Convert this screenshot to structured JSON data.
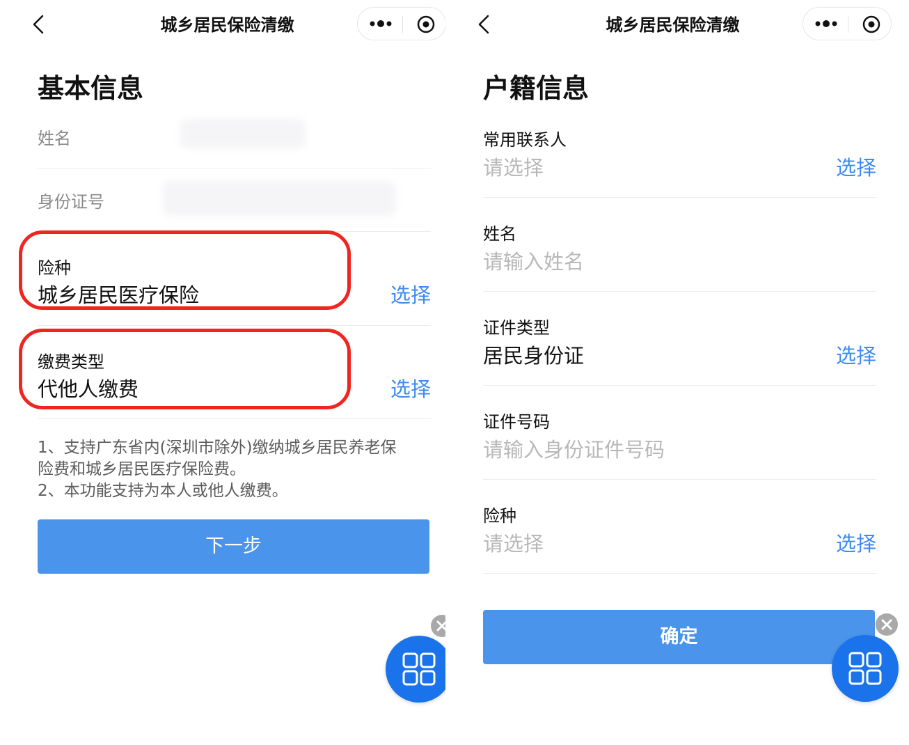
{
  "left": {
    "nav": {
      "title": "城乡居民保险清缴"
    },
    "section_title": "基本信息",
    "fields": {
      "name": {
        "label": "姓名"
      },
      "id_number": {
        "label": "身份证号"
      },
      "insurance_type": {
        "label": "险种",
        "value": "城乡居民医疗保险",
        "action": "选择"
      },
      "payment_type": {
        "label": "缴费类型",
        "value": "代他人缴费",
        "action": "选择"
      }
    },
    "notes": [
      "1、支持广东省内(深圳市除外)缴纳城乡居民养老保",
      "险费和城乡居民医疗保险费。",
      "2、本功能支持为本人或他人缴费。"
    ],
    "next_button": "下一步"
  },
  "right": {
    "nav": {
      "title": "城乡居民保险清缴"
    },
    "section_title": "户籍信息",
    "fields": {
      "contact": {
        "label": "常用联系人",
        "placeholder": "请选择",
        "action": "选择"
      },
      "name": {
        "label": "姓名",
        "placeholder": "请输入姓名"
      },
      "id_type": {
        "label": "证件类型",
        "value": "居民身份证",
        "action": "选择"
      },
      "id_number": {
        "label": "证件号码",
        "placeholder": "请输入身份证件号码"
      },
      "insurance_type": {
        "label": "险种",
        "placeholder": "请选择",
        "action": "选择"
      }
    },
    "confirm_button": "确定"
  },
  "colors": {
    "accent": "#3d8af0",
    "button": "#4a94ec",
    "highlight": "#f0251f",
    "float_button": "#1a73ea"
  },
  "icons": [
    "back-arrow-icon",
    "more-dots-icon",
    "close-target-icon",
    "close-circle-icon",
    "grid-menu-icon"
  ]
}
